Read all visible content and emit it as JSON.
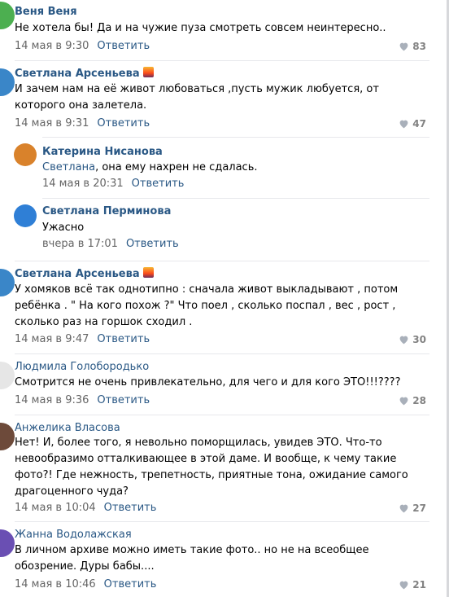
{
  "comments": [
    {
      "author": "Веня Веня",
      "text": "Не хотела бы! Да и на чужие пуза смотреть совсем неинтересно..",
      "date": "14 мая в 9:30",
      "reply": "Ответить",
      "likes": "83",
      "avatar_color": "#4caf50"
    },
    {
      "author": "Светлана Арсеньева",
      "text": "И зачем нам на её живот любоваться ,пусть мужик любуется, от которого она залетела.",
      "date": "14 мая в 9:31",
      "reply": "Ответить",
      "likes": "47",
      "avatar_color": "#3a86c8"
    },
    {
      "author": "Катерина Нисанова",
      "mention": "Светлана",
      "text": ", она ему нахрен не сдалась.",
      "date": "14 мая в 20:31",
      "reply": "Ответить",
      "avatar_color": "#d9822b"
    },
    {
      "author": "Светлана Перминова",
      "text": "Ужасно",
      "date": "вчера в 17:01",
      "reply": "Ответить",
      "avatar_color": "#2f7fd6"
    },
    {
      "author": "Светлана Арсеньева",
      "text": "У хомяков всё так однотипно : сначала живот выкладывают , потом ребёнка . \" На кого похож ?\" Что поел , сколько поспал , вес , рост , сколько раз на горшок сходил .",
      "date": "14 мая в 9:47",
      "reply": "Ответить",
      "likes": "30",
      "avatar_color": "#3a86c8"
    },
    {
      "author": "Людмила Голобородько",
      "text": "Смотрится не очень привлекательно, для чего и для кого ЭТО!!!????",
      "date": "14 мая в 9:36",
      "reply": "Ответить",
      "likes": "28",
      "avatar_color": "#e6e6e6"
    },
    {
      "author": "Анжелика Власова",
      "text": "Нет! И, более того, я невольно поморщилась, увидев ЭТО. Что-то невообразимо отталкивающее в этой даме. И вообще, к чему такие фото?! Где нежность, трепетность, приятные тона, ожидание самого драгоценного чуда?",
      "date": "14 мая в 10:04",
      "reply": "Ответить",
      "likes": "27",
      "avatar_color": "#6d4a3a"
    },
    {
      "author": "Жанна Водолажская",
      "text": "В личном архиве можно иметь такие фото.. но не на всеобщее обозрение. Дуры бабы....",
      "date": "14 мая в 10:46",
      "reply": "Ответить",
      "likes": "21",
      "avatar_color": "#6a4fb3"
    }
  ]
}
